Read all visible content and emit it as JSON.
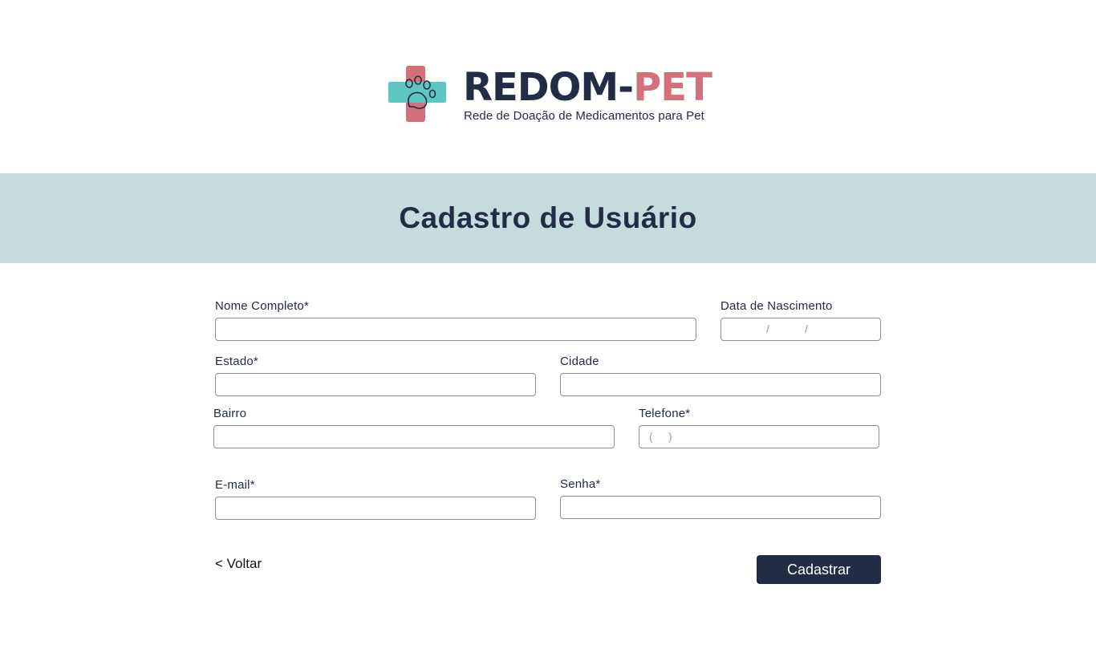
{
  "header": {
    "logo": {
      "brand_part1": "REDOM-",
      "brand_part2": "PET",
      "tagline": "Rede de Doação de Medicamentos para Pet"
    }
  },
  "banner": {
    "title": "Cadastro de Usuário"
  },
  "form": {
    "nome": {
      "label": "Nome Completo*",
      "value": ""
    },
    "nascimento": {
      "label": "Data de Nascimento",
      "value": "",
      "mask_sep1": "/",
      "mask_sep2": "/"
    },
    "estado": {
      "label": "Estado*",
      "value": ""
    },
    "cidade": {
      "label": "Cidade",
      "value": ""
    },
    "bairro": {
      "label": "Bairro",
      "value": ""
    },
    "telefone": {
      "label": "Telefone*",
      "value": "",
      "mask_open": "(",
      "mask_close": ")"
    },
    "email": {
      "label": "E-mail*",
      "value": ""
    },
    "senha": {
      "label": "Senha*",
      "value": ""
    }
  },
  "actions": {
    "back_label": "<  Voltar",
    "submit_label": "Cadastrar"
  },
  "colors": {
    "navy": "#222c44",
    "pink": "#d2707b",
    "teal": "#5fc6c2",
    "banner_bg": "#c5dcdd"
  }
}
